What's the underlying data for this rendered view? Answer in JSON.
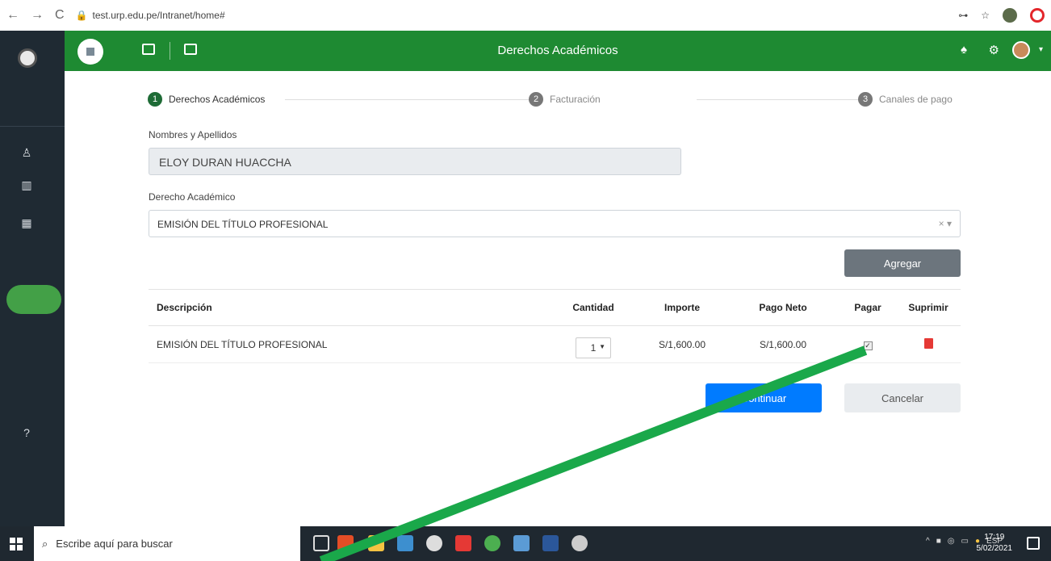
{
  "browser": {
    "url": "test.urp.edu.pe/Intranet/home#",
    "nav_back": "←",
    "nav_forward": "→",
    "nav_reload": "C"
  },
  "header": {
    "title": "Derechos Académicos"
  },
  "stepper": {
    "steps": [
      {
        "number": "1",
        "label": "Derechos Académicos"
      },
      {
        "number": "2",
        "label": "Facturación"
      },
      {
        "number": "3",
        "label": "Canales de pago"
      }
    ]
  },
  "form": {
    "name_label": "Nombres y Apellidos",
    "name_value": "ELOY DURAN HUACCHA",
    "derecho_label": "Derecho Académico",
    "derecho_value": "EMISIÓN DEL TÍTULO PROFESIONAL",
    "clear_symbol": "×",
    "add_button": "Agregar"
  },
  "table": {
    "headers": {
      "descripcion": "Descripción",
      "cantidad": "Cantidad",
      "importe": "Importe",
      "pago_neto": "Pago Neto",
      "pagar": "Pagar",
      "suprimir": "Suprimir"
    },
    "rows": [
      {
        "descripcion": "EMISIÓN DEL TÍTULO PROFESIONAL",
        "cantidad": "1",
        "importe": "S/1,600.00",
        "pago_neto": "S/1,600.00",
        "pagar_checked": true
      }
    ]
  },
  "actions": {
    "continue_button": "Continuar",
    "cancel_button": "Cancelar"
  },
  "taskbar": {
    "search_placeholder": "Escribe aquí para buscar",
    "language": "ESP",
    "time": "17:19",
    "date": "5/02/2021"
  },
  "colors": {
    "header_green": "#1e8a32",
    "sidebar_dark": "#1f2a33",
    "primary_blue": "#007bff",
    "annotation_arrow": "#1aa84a"
  }
}
